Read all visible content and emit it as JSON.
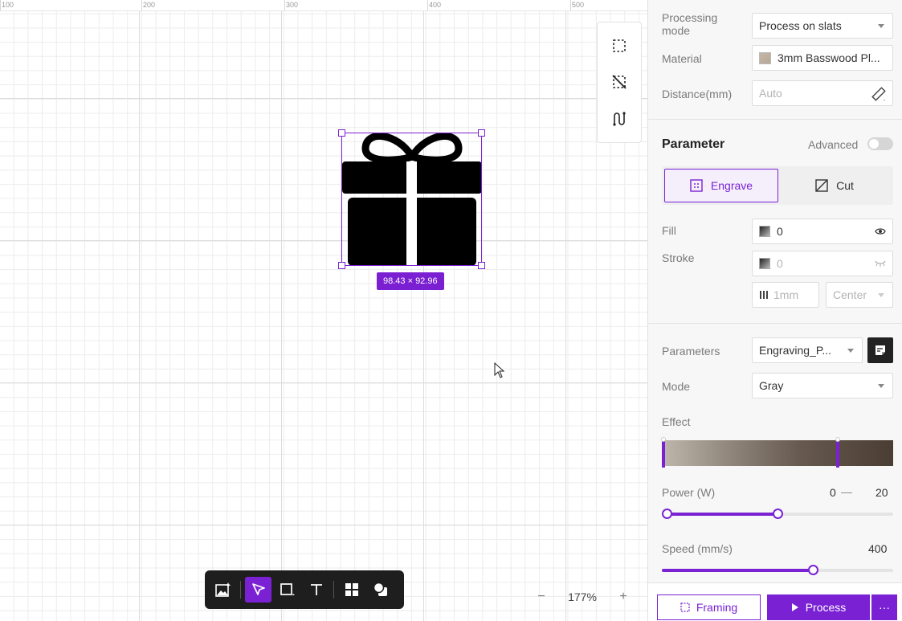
{
  "ruler": {
    "labels": [
      "100",
      "200",
      "300",
      "400",
      "500"
    ]
  },
  "canvas": {
    "selection_size": "98.43 × 92.96",
    "zoom": {
      "value": "177%",
      "minus": "−",
      "plus": "+"
    }
  },
  "float_tools": [
    "select-area-icon",
    "deselect-icon",
    "path-icon"
  ],
  "bottom_tools": [
    "add-image-icon",
    "select-tool-icon",
    "rectangle-tool-icon",
    "text-tool-icon",
    "components-icon",
    "shapes-icon"
  ],
  "panel": {
    "processing_mode": {
      "label": "Processing mode",
      "value": "Process on slats"
    },
    "material": {
      "label": "Material",
      "value": "3mm Basswood Pl..."
    },
    "distance": {
      "label": "Distance(mm)",
      "value": "Auto"
    },
    "parameter": {
      "title": "Parameter",
      "advanced_label": "Advanced",
      "advanced_on": false
    },
    "tabs": [
      {
        "label": "Engrave",
        "active": true
      },
      {
        "label": "Cut",
        "active": false
      }
    ],
    "fill": {
      "label": "Fill",
      "value": "0"
    },
    "stroke": {
      "label": "Stroke",
      "value": "0",
      "width": "1mm",
      "align": "Center"
    },
    "parameters": {
      "label": "Parameters",
      "value": "Engraving_P..."
    },
    "mode": {
      "label": "Mode",
      "value": "Gray"
    },
    "effect": {
      "label": "Effect"
    },
    "power": {
      "label": "Power (W)",
      "min": "0",
      "dash": "—",
      "max": "20",
      "fraction": 0.5
    },
    "speed": {
      "label": "Speed (mm/s)",
      "value": "400",
      "fraction": 0.66
    },
    "footer": {
      "framing": "Framing",
      "process": "Process",
      "more": "···"
    }
  },
  "colors": {
    "accent": "#7a22d3"
  }
}
